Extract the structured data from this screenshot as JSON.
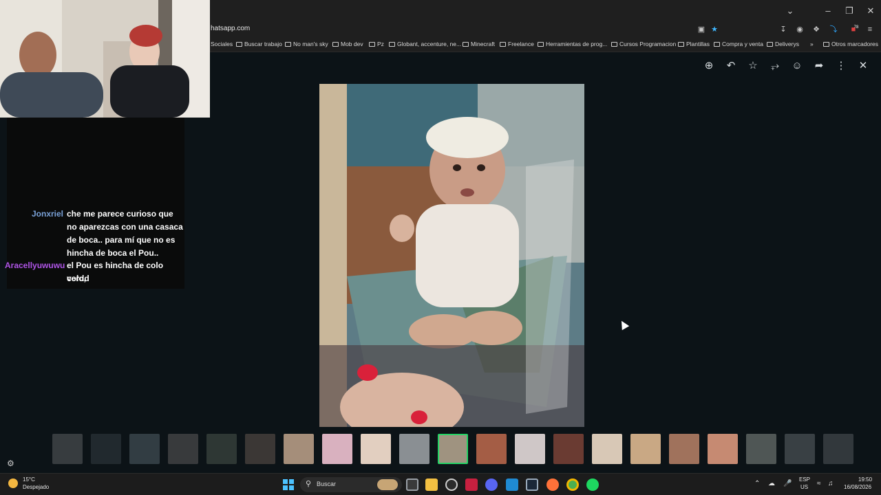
{
  "browser": {
    "url_fragment": "hatsapp.com",
    "bookmarks": [
      "Sociales",
      "Buscar trabajo",
      "No man's sky",
      "Mob dev",
      "Pz",
      "Globant, accenture, ne...",
      "Minecraft",
      "Freelance",
      "Herramientas de prog...",
      "Cursos Programacion",
      "Plantillas",
      "Compra y venta",
      "Deliverys",
      "Otros marcadores"
    ],
    "extension_badge": "78"
  },
  "viewer": {
    "toolbar_icons": [
      "zoom-in-icon",
      "reply-icon",
      "star-icon",
      "pin-icon",
      "emoji-icon",
      "forward-icon",
      "more-icon",
      "close-icon"
    ],
    "thumbnails_count": 21,
    "active_thumbnail": 11
  },
  "chat": {
    "messages": [
      {
        "user": "Jonxriel",
        "text": [
          "che me parece curioso que",
          "no aparezcas con una casaca",
          "de boca.. para mí que no es",
          "hincha de boca el Pou.."
        ]
      },
      {
        "user": "Aracellyuwuwu",
        "text": [
          "el Pou es hincha de colo colo,",
          "verdd"
        ]
      }
    ]
  },
  "taskbar": {
    "weather_temp": "15°C",
    "weather_desc": "Despejado",
    "search_label": "Buscar",
    "lang": "ESP",
    "layout": "US",
    "time": "19:50",
    "date": "16/08/2026"
  },
  "colors": {
    "accent": "#25d366",
    "user1": "#7aa2d9",
    "user2": "#b055e8"
  }
}
